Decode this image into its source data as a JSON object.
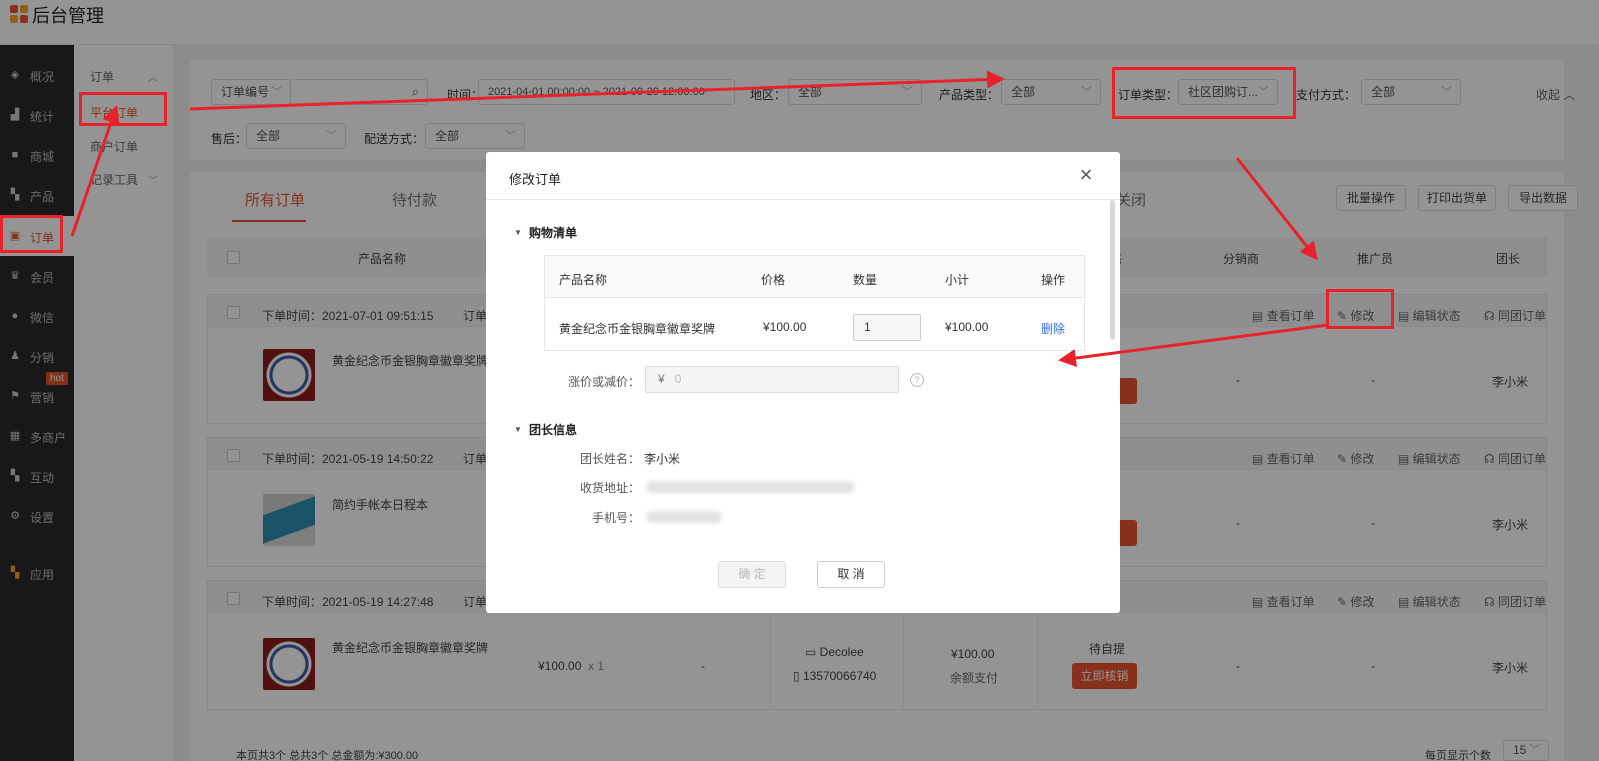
{
  "app": {
    "title": "后台管理"
  },
  "sidebar": {
    "items": [
      {
        "label": "概况",
        "icon": "layers-icon"
      },
      {
        "label": "统计",
        "icon": "chart-icon"
      },
      {
        "label": "商城",
        "icon": "shop-icon"
      },
      {
        "label": "产品",
        "icon": "grid-icon"
      },
      {
        "label": "订单",
        "icon": "clipboard-icon"
      },
      {
        "label": "会员",
        "icon": "crown-icon"
      },
      {
        "label": "微信",
        "icon": "wechat-icon"
      },
      {
        "label": "分销",
        "icon": "users-icon"
      },
      {
        "label": "营销",
        "icon": "flag-icon"
      },
      {
        "label": "多商户",
        "icon": "store-icon"
      },
      {
        "label": "互动",
        "icon": "apps-icon"
      },
      {
        "label": "设置",
        "icon": "gear-icon"
      },
      {
        "label": "应用",
        "icon": "colorful-apps-icon"
      }
    ],
    "hot_badge": "hot"
  },
  "subnav": {
    "group": "订单",
    "items": [
      "平台订单",
      "商户订单",
      "记录工具"
    ]
  },
  "filters": {
    "order_no_select": "订单编号",
    "time_label": "时间：",
    "time_value": "2021-04-01 00:00:00 ~ 2021-09-29 12:00:00",
    "region_label": "地区：",
    "region_value": "全部",
    "product_type_label": "产品类型：",
    "product_type_value": "全部",
    "order_type_label": "订单类型：",
    "order_type_value": "社区团购订...",
    "payment_label": "支付方式：",
    "payment_value": "全部",
    "collapse": "收起",
    "aftersale_label": "售后：",
    "aftersale_value": "全部",
    "delivery_label": "配送方式：",
    "delivery_value": "全部"
  },
  "tabs": [
    "所有订单",
    "待付款",
    "关闭"
  ],
  "toolbar": {
    "batch": "批量操作",
    "print": "打印出货单",
    "export": "导出数据"
  },
  "table": {
    "headers": {
      "product": "产品名称",
      "status": "态",
      "distributor": "分销商",
      "promoter": "推广员",
      "leader": "团长"
    }
  },
  "orders": [
    {
      "time": "下单时间：2021-07-01 09:51:15",
      "no_label": "订单",
      "product": "黄金纪念币金银胸章徽章奖牌",
      "distributor": "-",
      "promoter": "-",
      "leader": "李小米"
    },
    {
      "time": "下单时间：2021-05-19 14:50:22",
      "no_label": "订单",
      "product": "简约手帐本日程本",
      "distributor": "-",
      "promoter": "-",
      "leader": "李小米"
    },
    {
      "time": "下单时间：2021-05-19 14:27:48",
      "no_label": "订单",
      "product": "黄金纪念币金银胸章徽章奖牌",
      "price": "¥100.00",
      "qty": "x 1",
      "discount": "-",
      "buyer": "Decolee",
      "phone": "13570066740",
      "total": "¥100.00",
      "pay_method": "余额支付",
      "status": "待自提",
      "action": "立即核销",
      "distributor": "-",
      "promoter": "-",
      "leader": "李小米"
    }
  ],
  "order_actions": {
    "view": "查看订单",
    "edit": "修改",
    "edit_status": "编辑状态",
    "group_order": "同团订单"
  },
  "footer": {
    "summary": "本页共3个 总共3个 总金额为:¥300.00",
    "page_size_label": "每页显示个数",
    "page_size": "15"
  },
  "modal": {
    "title": "修改订单",
    "cart_section": "购物清单",
    "cart_headers": [
      "产品名称",
      "价格",
      "数量",
      "小计",
      "操作"
    ],
    "cart_item": {
      "name": "黄金纪念币金银胸章徽章奖牌",
      "price": "¥100.00",
      "qty": "1",
      "subtotal": "¥100.00",
      "action": "删除"
    },
    "adjust_label": "涨价或减价：",
    "adjust_currency": "¥",
    "adjust_placeholder": "0",
    "leader_section": "团长信息",
    "leader_name_label": "团长姓名：",
    "leader_name": "李小米",
    "address_label": "收货地址：",
    "phone_label": "手机号：",
    "confirm": "确 定",
    "cancel": "取 消"
  },
  "colors": {
    "accent": "#e8542f",
    "annotation": "#e8222a",
    "sidebar_bg": "#2a2a2a"
  }
}
